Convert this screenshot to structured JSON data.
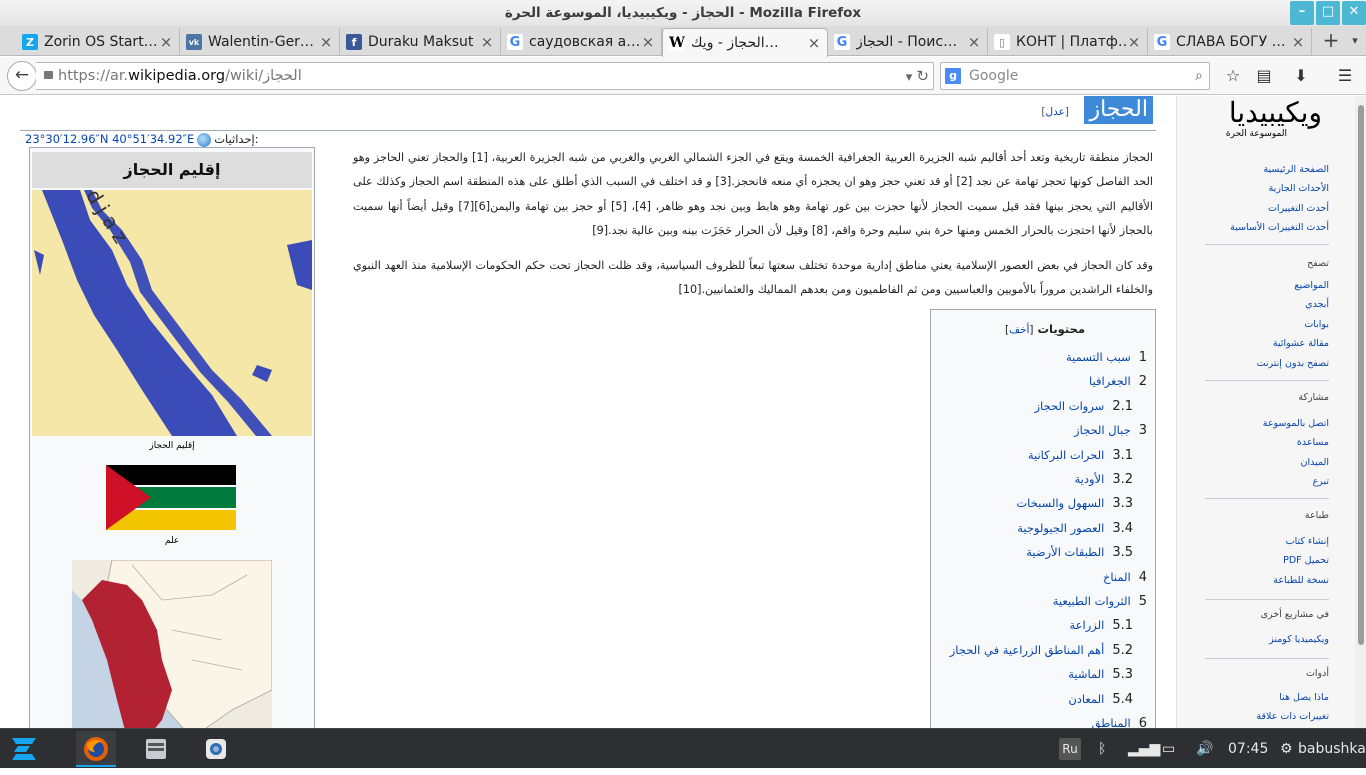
{
  "window": {
    "title": "الحجاز - ويكيبيديا، الموسوعة الحرة - Mozilla Firefox",
    "buttons": {
      "minimize": "–",
      "maximize": "□",
      "close": "✕"
    }
  },
  "tabs": [
    {
      "label": "Zorin OS Start…",
      "favicon": "zorin-icon",
      "color": "#15a6f0"
    },
    {
      "label": "Walentin-Ger…",
      "favicon": "vk-icon",
      "color": "#4c75a3"
    },
    {
      "label": "Duraku Maksut",
      "favicon": "facebook-icon",
      "color": "#3b5998"
    },
    {
      "label": "саудовская а…",
      "favicon": "google-icon",
      "color": "#4285f4"
    },
    {
      "label": "الحجاز - ويك…",
      "favicon": "wikipedia-icon",
      "color": "#000000",
      "active": true
    },
    {
      "label": "الحجاز - Поис…",
      "favicon": "google-icon",
      "color": "#4285f4"
    },
    {
      "label": "КОНТ | Платф…",
      "favicon": "page-icon",
      "color": "#777777"
    },
    {
      "label": "СЛАВА БОГУ …",
      "favicon": "google-icon",
      "color": "#4285f4"
    }
  ],
  "nav": {
    "url_prefix": "https://ar.",
    "url_domain": "wikipedia.org",
    "url_path": "/wiki/الحجاز",
    "search_placeholder": "Google"
  },
  "sidebar": {
    "logo": "ويكيبيديا",
    "logo_sub": "الموسوعة الحرة",
    "main": [
      "الصفحة الرئيسية",
      "الأحداث الجارية",
      "أحدث التغييرات",
      "أحدث التغييرات الأساسية"
    ],
    "browse_head": "تصفح",
    "browse": [
      "المواضيع",
      "أبجدي",
      "بوابات",
      "مقالة عشوائية",
      "تصفح بدون إنترنت"
    ],
    "share_head": "مشاركة",
    "share": [
      "اتصل بالموسوعة",
      "مساعدة",
      "الميدان",
      "تبرع"
    ],
    "print_head": "طباعة",
    "print": [
      "إنشاء كتاب",
      "تحميل PDF",
      "نسخة للطباعة"
    ],
    "other_head": "في مشاريع أخرى",
    "other": [
      "ويكيميديا كومنز"
    ],
    "tools_head": "أدوات",
    "tools": [
      "ماذا يصل هنا",
      "تغييرات ذات علاقة"
    ]
  },
  "article": {
    "title": "الحجاز",
    "edit": "عدل",
    "coords_label": "إحداثيات",
    "coords": "23°30′12.96″N 40°51′34.92″E",
    "p1": "الحجاز منطقة تاريخية وتعد أحد أقاليم شبه الجزيرة العربية الجغرافية الخمسة ويقع في الجزء الشمالي الغربي والغربي من شبه الجزيرة العربية، [1] والحجاز تعني الحاجز وهو الحد الفاصل كونها تحجز تهامة عن نجد [2] أو قد تعني حجز وهو ان يحجزه أي منعه فانحجز.[3] و قد اختلف في السبب الذي أطلق على هذه المنطقة اسم الحجاز وكذلك على الأقاليم التي يحجز بينها فقد قيل سميت الحجاز لأنها حجزت بين غور تهامة وهو هابط وبين نجد وهو ظاهر، [4]، [5] أو حجز بين تهامة واليمن[6][7] وقيل أيضاً أنها سميت بالحجاز لأنها احتجزت بالحرار الخمس ومنها حرة بني سليم وحرة واقم، [8] وقيل لأن الحرار حَجَزَت بينه وبين عالية نجد.[9]",
    "p2": "وقد كان الحجاز في بعض العصور الإسلامية يعني مناطق إدارية موحدة تختلف سعتها تبعاً للظروف السياسية، وقد ظلت الحجاز تحت حكم الحكومات الإسلامية منذ العهد النبوي والخلفاء الراشدين مروراً بالأمويين والعباسيين ومن ثم الفاطميون ومن بعدهم المماليك والعثمانيين.[10]"
  },
  "infobox": {
    "title": "إقليم الحجاز",
    "map_label": "Hidjaz",
    "map_caption": "إقليم الحجاز",
    "flag_caption": "علم",
    "flag_colors": {
      "black": "#000000",
      "green": "#007a3d",
      "white": "#ffffff",
      "gold": "#f2c500",
      "red": "#ce1126"
    }
  },
  "toc": {
    "title": "محتويات",
    "hide": "أخف",
    "items": [
      {
        "num": "1",
        "label": "سبب التسمية",
        "level": 1
      },
      {
        "num": "2",
        "label": "الجغرافيا",
        "level": 1
      },
      {
        "num": "2.1",
        "label": "سروات الحجاز",
        "level": 2
      },
      {
        "num": "3",
        "label": "جبال الحجاز",
        "level": 1
      },
      {
        "num": "3.1",
        "label": "الحرات البركانية",
        "level": 2
      },
      {
        "num": "3.2",
        "label": "الأودية",
        "level": 2
      },
      {
        "num": "3.3",
        "label": "السهول والسبخات",
        "level": 2
      },
      {
        "num": "3.4",
        "label": "العصور الجيولوجية",
        "level": 2
      },
      {
        "num": "3.5",
        "label": "الطبقات الأرضية",
        "level": 2
      },
      {
        "num": "4",
        "label": "المناخ",
        "level": 1
      },
      {
        "num": "5",
        "label": "الثروات الطبيعية",
        "level": 1
      },
      {
        "num": "5.1",
        "label": "الزراعة",
        "level": 2
      },
      {
        "num": "5.2",
        "label": "أهم المناطق الزراعية في الحجاز",
        "level": 2
      },
      {
        "num": "5.3",
        "label": "الماشية",
        "level": 2
      },
      {
        "num": "5.4",
        "label": "المعادن",
        "level": 2
      },
      {
        "num": "6",
        "label": "المناطق",
        "level": 1
      }
    ]
  },
  "taskbar": {
    "lang": "Ru",
    "time": "07:45",
    "user": "babushka"
  }
}
